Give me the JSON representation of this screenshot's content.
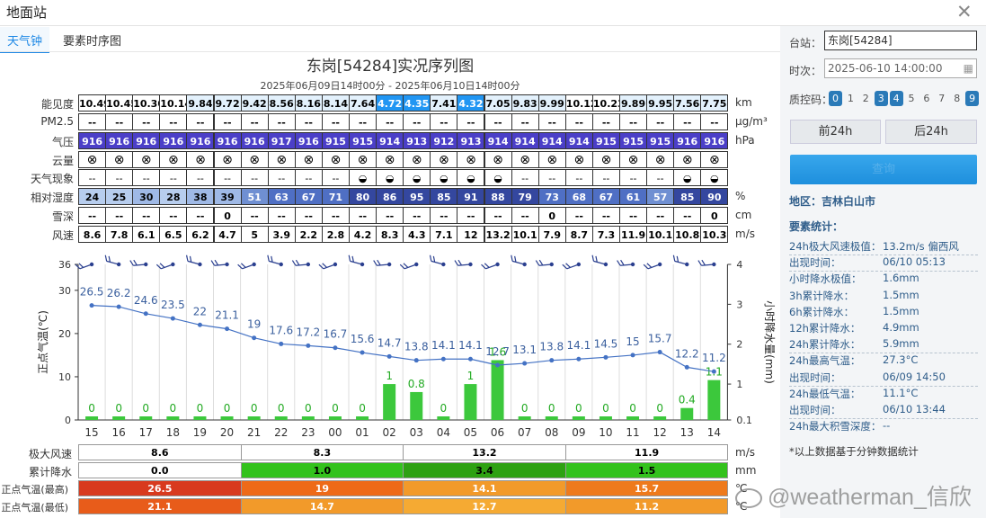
{
  "window": {
    "title": "地面站"
  },
  "tabs": [
    "天气钟",
    "要素时序图"
  ],
  "chart": {
    "title": "东岗[54284]实况序列图",
    "subtitle": "2025年06月09日14时00分 - 2025年06月10日14时00分",
    "y_left_label": "正点气温(℃)",
    "y_right_label": "小时降水量(mm)",
    "y_left_ticks": [
      "36",
      "30",
      "20",
      "10",
      "0"
    ],
    "y_right_ticks": [
      "4",
      "3",
      "2",
      "1",
      "0.1"
    ]
  },
  "table": {
    "rows": [
      {
        "label": "能见度",
        "unit": "km",
        "values": [
          "10.49",
          "10.45",
          "10.30",
          "10.14",
          "9.84",
          "9.72",
          "9.42",
          "8.56",
          "8.16",
          "8.14",
          "7.64",
          "4.72",
          "4.35",
          "7.41",
          "4.32",
          "7.05",
          "9.83",
          "9.99",
          "10.12",
          "10.23",
          "9.89",
          "9.95",
          "7.56",
          "7.75"
        ]
      },
      {
        "label": "PM2.5",
        "unit": "μg/m³",
        "values": [
          "--",
          "--",
          "--",
          "--",
          "--",
          "--",
          "--",
          "--",
          "--",
          "--",
          "--",
          "--",
          "--",
          "--",
          "--",
          "--",
          "--",
          "--",
          "--",
          "--",
          "--",
          "--",
          "--",
          "--"
        ]
      },
      {
        "label": "气压",
        "unit": "hPa",
        "values": [
          "916",
          "916",
          "916",
          "916",
          "916",
          "916",
          "916",
          "917",
          "916",
          "915",
          "915",
          "914",
          "913",
          "912",
          "913",
          "914",
          "914",
          "914",
          "914",
          "915",
          "915",
          "915",
          "916",
          "916"
        ]
      },
      {
        "label": "云量",
        "unit": "",
        "values": [
          "⊗",
          "⊗",
          "⊗",
          "⊗",
          "⊗",
          "⊗",
          "⊗",
          "⊗",
          "⊗",
          "⊗",
          "⊗",
          "⊗",
          "⊗",
          "⊗",
          "⊗",
          "⊗",
          "⊗",
          "⊗",
          "⊗",
          "⊗",
          "⊗",
          "⊗",
          "⊗",
          "⊗"
        ]
      },
      {
        "label": "天气现象",
        "unit": "",
        "values": [
          "--",
          "--",
          "--",
          "--",
          "--",
          "--",
          "--",
          "--",
          "--",
          "--",
          "◒",
          "◒",
          "◒",
          "◒",
          "◒",
          "◒",
          "--",
          "--",
          "--",
          "--",
          "--",
          "--",
          "◒",
          "◒"
        ]
      },
      {
        "label": "相对湿度",
        "unit": "%",
        "values": [
          "24",
          "25",
          "30",
          "28",
          "38",
          "39",
          "51",
          "63",
          "67",
          "71",
          "80",
          "86",
          "95",
          "85",
          "91",
          "88",
          "79",
          "73",
          "68",
          "67",
          "61",
          "57",
          "85",
          "90"
        ]
      },
      {
        "label": "雪深",
        "unit": "cm",
        "values": [
          "--",
          "--",
          "--",
          "--",
          "--",
          "0",
          "--",
          "--",
          "--",
          "--",
          "--",
          "--",
          "--",
          "--",
          "--",
          "--",
          "--",
          "0",
          "--",
          "--",
          "--",
          "--",
          "--",
          "0"
        ]
      },
      {
        "label": "风速",
        "unit": "m/s",
        "values": [
          "8.6",
          "7.8",
          "6.1",
          "6.5",
          "6.2",
          "4.7",
          "5",
          "3.9",
          "2.2",
          "2.8",
          "4.2",
          "8.3",
          "4.3",
          "7.1",
          "12",
          "13.2",
          "10.1",
          "7.9",
          "8.7",
          "7.3",
          "11.9",
          "10.1",
          "10.8",
          "10.3"
        ]
      }
    ]
  },
  "chart_data": {
    "type": "line",
    "x": [
      "15",
      "16",
      "17",
      "18",
      "19",
      "20",
      "21",
      "22",
      "23",
      "00",
      "01",
      "02",
      "03",
      "04",
      "05",
      "06",
      "07",
      "08",
      "09",
      "10",
      "11",
      "12",
      "13",
      "14"
    ],
    "series": [
      {
        "values": [
          26.5,
          26.2,
          24.6,
          23.5,
          22,
          21.1,
          19,
          17.6,
          17.2,
          16.7,
          15.6,
          14.7,
          13.8,
          14.1,
          14.1,
          12.7,
          13.1,
          13.8,
          14.1,
          14.5,
          15,
          15.7,
          12.2,
          11.2
        ]
      },
      {
        "values": [
          0,
          0,
          0,
          0,
          0,
          0,
          0,
          0,
          0,
          0,
          0,
          1,
          0.8,
          0,
          1,
          1.6,
          0,
          0,
          0,
          0,
          0,
          0,
          0.4,
          1.1
        ]
      }
    ],
    "ylim": [
      0,
      36
    ],
    "y2lim": [
      0.1,
      4
    ]
  },
  "summary": {
    "rows": [
      {
        "label": "极大风速",
        "unit": "m/s",
        "values": [
          "8.6",
          "8.3",
          "13.2",
          "11.9"
        ]
      },
      {
        "label": "累计降水",
        "unit": "mm",
        "values": [
          "0.0",
          "1.0",
          "3.4",
          "1.5"
        ]
      },
      {
        "label": "正点气温(最高)",
        "unit": "℃",
        "values": [
          "26.5",
          "19",
          "14.1",
          "15.7"
        ]
      },
      {
        "label": "正点气温(最低)",
        "unit": "℃",
        "values": [
          "21.1",
          "14.7",
          "12.7",
          "11.2"
        ]
      }
    ]
  },
  "side": {
    "station_label": "台站：",
    "station_value": "东岗[54284]",
    "time_label": "时次：",
    "time_value": "2025-06-10 14:00:00",
    "qc_label": "质控码：",
    "qc_codes": [
      "0",
      "1",
      "2",
      "3",
      "4",
      "5",
      "6",
      "7",
      "8",
      "9"
    ],
    "prev_label": "前24h",
    "next_label": "后24h",
    "search_label": "查询",
    "region": "地区：吉林白山市",
    "stats_title": "要素统计：",
    "stats": [
      {
        "k": "24h极大风速极值：",
        "v": "13.2m/s 偏西风"
      },
      {
        "k": "出现时间：",
        "v": "06/10 05:13"
      },
      {
        "k": "小时降水极值：",
        "v": "1.6mm"
      },
      {
        "k": "3h累计降水：",
        "v": "1.5mm"
      },
      {
        "k": "6h累计降水：",
        "v": "1.5mm"
      },
      {
        "k": "12h累计降水：",
        "v": "4.9mm"
      },
      {
        "k": "24h累计降水：",
        "v": "5.9mm"
      },
      {
        "k": "24h最高气温：",
        "v": "27.3°C"
      },
      {
        "k": "出现时间：",
        "v": "06/09 14:50"
      },
      {
        "k": "24h最低气温：",
        "v": "11.1°C"
      },
      {
        "k": "出现时间：",
        "v": "06/10 13:44"
      },
      {
        "k": "24h最大积雪深度：",
        "v": "--"
      }
    ],
    "note": "*以上数据基于分钟数据统计"
  },
  "watermark": "@weatherman_信欣",
  "colors": {
    "accent": "#1e88e5",
    "line": "#4472c4",
    "bar": "#3cc83c"
  }
}
